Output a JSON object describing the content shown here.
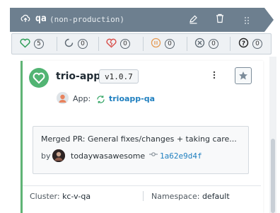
{
  "header": {
    "title": "qa",
    "subtitle": "(non-production)",
    "icons": [
      "cloud-upload-icon",
      "edit-icon",
      "trash-icon",
      "drag-handle-icon"
    ]
  },
  "status_bar": {
    "items": [
      {
        "name": "healthy",
        "icon": "heart-icon",
        "count": "5",
        "color": "#2e9d57"
      },
      {
        "name": "progressing",
        "icon": "progress-circle-icon",
        "count": "0",
        "color": "#5b6670"
      },
      {
        "name": "degraded",
        "icon": "broken-heart-icon",
        "count": "0",
        "color": "#d9534f"
      },
      {
        "name": "suspended",
        "icon": "pause-icon",
        "count": "0",
        "color": "#e59a53"
      },
      {
        "name": "missing",
        "icon": "x-circle-icon",
        "count": "0",
        "color": "#5b6670"
      },
      {
        "name": "unknown",
        "icon": "question-icon",
        "count": "0",
        "color": "#222222"
      }
    ]
  },
  "card": {
    "app_name": "trio-app",
    "version": "v1.0.7",
    "app_label": "App:",
    "app_link": "trioapp-qa",
    "pr_title": "Merged PR: General fixes/changes + taking care...",
    "pr_by": "by",
    "pr_user": "todaywasawesome",
    "commit_sha": "1a62e9d4f",
    "cluster_label": "Cluster:",
    "cluster_value": "kc-v-qa",
    "namespace_label": "Namespace:",
    "namespace_value": "default"
  },
  "colors": {
    "header_bg": "#6d7f8f",
    "healthy_green": "#5fb475",
    "link_blue": "#1f7fbf"
  }
}
